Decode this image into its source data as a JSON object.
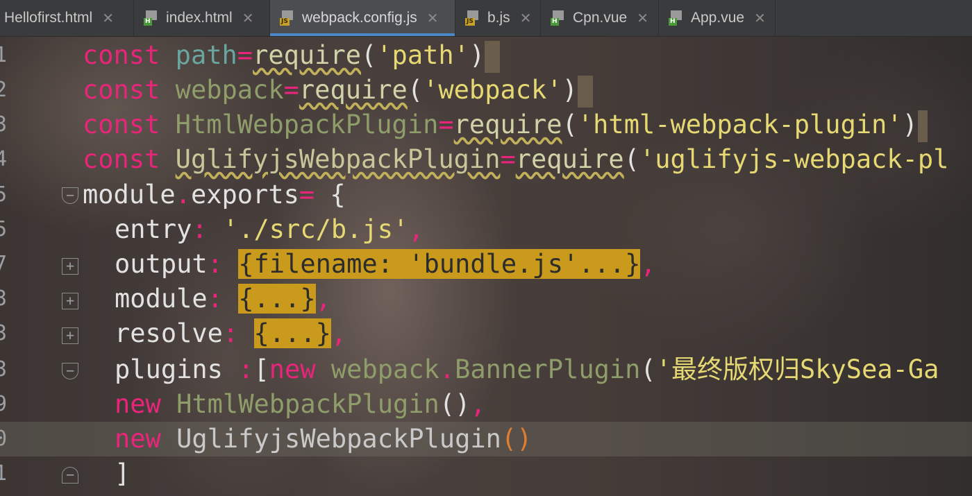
{
  "tabs": [
    {
      "label": "Hellofirst.html",
      "icon": "html-file-icon",
      "badge": "H"
    },
    {
      "label": "index.html",
      "icon": "html-file-icon",
      "badge": "H"
    },
    {
      "label": "webpack.config.js",
      "icon": "js-file-icon",
      "badge": "JS",
      "active": true
    },
    {
      "label": "b.js",
      "icon": "js-file-icon",
      "badge": "JS"
    },
    {
      "label": "Cpn.vue",
      "icon": "vue-file-icon",
      "badge": "H"
    },
    {
      "label": "App.vue",
      "icon": "vue-file-icon",
      "badge": "H"
    }
  ],
  "close_glyph": "✕",
  "gutter": [
    "1",
    "2",
    "3",
    "4",
    "5",
    "5",
    "7",
    "3",
    "3",
    "3",
    "9",
    "0",
    "1"
  ],
  "code": {
    "l1": {
      "kw": "const",
      "var": "path",
      "op": "=",
      "fn": "require",
      "open": "(",
      "str": "'path'",
      "close": ")"
    },
    "l2": {
      "kw": "const",
      "var": "webpack",
      "op": "=",
      "fn": "require",
      "open": "(",
      "str": "'webpack'",
      "close": ")"
    },
    "l3": {
      "kw": "const",
      "var": "HtmlWebpackPlugin",
      "op": "=",
      "fn": "require",
      "open": "(",
      "str": "'html-webpack-plugin'",
      "close": ")"
    },
    "l4": {
      "kw": "const",
      "var": "UglifyjsWebpackPlugin",
      "op": "=",
      "fn": "require",
      "open": "(",
      "str": "'uglifyjs-webpack-pl"
    },
    "l5": {
      "obj": "module",
      "dot": ".",
      "prop": "exports",
      "op": "=",
      "rest": " {"
    },
    "l6": {
      "key": "entry",
      "colon": ":",
      "str": "'./src/b.js'",
      "comma": ","
    },
    "l7": {
      "key": "output",
      "colon": ":",
      "folded": "{filename: 'bundle.js'...}",
      "comma": ","
    },
    "l8": {
      "key": "module",
      "colon": ":",
      "folded": "{...}",
      "comma": ","
    },
    "l9": {
      "key": "resolve",
      "colon": ":",
      "folded": "{...}",
      "comma": ","
    },
    "l10": {
      "key": "plugins",
      "colon": ":",
      "bracket": "[",
      "kw": "new",
      "obj": "webpack",
      "dot": ".",
      "cls": "BannerPlugin",
      "open": "(",
      "str": "'最终版权归SkySea-Ga"
    },
    "l11": {
      "kw": "new",
      "cls": "HtmlWebpackPlugin",
      "call": "()",
      "comma": ","
    },
    "l12": {
      "kw": "new",
      "cls": "UglifyjsWebpackPlugin",
      "call": "()"
    },
    "l13": {
      "bracket": "]"
    }
  },
  "colors": {
    "keyword": "#e8257a",
    "string": "#e6d974",
    "fold_highlight": "#c99a1c",
    "active_tab_underline": "#4a88c7"
  }
}
